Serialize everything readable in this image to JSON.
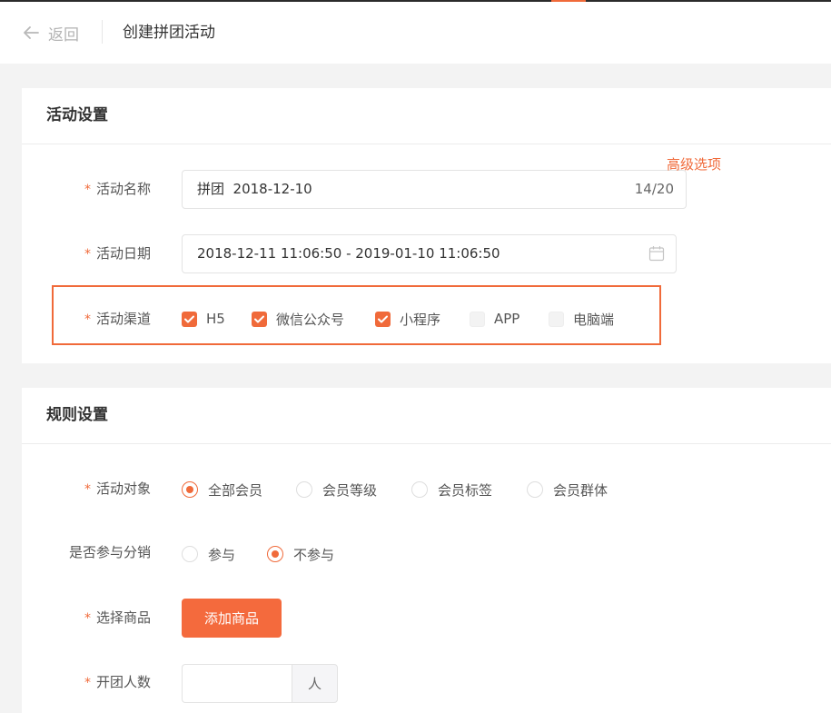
{
  "header": {
    "back_label": "返回",
    "title": "创建拼团活动"
  },
  "activity_settings": {
    "section_title": "活动设置",
    "name": {
      "label": "活动名称",
      "value": "拼团  2018-12-10",
      "counter": "14/20"
    },
    "date": {
      "label": "活动日期",
      "value": "2018-12-11 11:06:50 - 2019-01-10 11:06:50",
      "advanced_link": "高级选项"
    },
    "channels": {
      "label": "活动渠道",
      "options": [
        {
          "label": "H5",
          "checked": true
        },
        {
          "label": "微信公众号",
          "checked": true
        },
        {
          "label": "小程序",
          "checked": true
        },
        {
          "label": "APP",
          "checked": false
        },
        {
          "label": "电脑端",
          "checked": false
        }
      ]
    }
  },
  "rule_settings": {
    "section_title": "规则设置",
    "target": {
      "label": "活动对象",
      "options": [
        {
          "label": "全部会员",
          "selected": true
        },
        {
          "label": "会员等级",
          "selected": false
        },
        {
          "label": "会员标签",
          "selected": false
        },
        {
          "label": "会员群体",
          "selected": false
        }
      ]
    },
    "distribution": {
      "label": "是否参与分销",
      "options": [
        {
          "label": "参与",
          "selected": false
        },
        {
          "label": "不参与",
          "selected": true
        }
      ]
    },
    "product": {
      "label": "选择商品",
      "button_label": "添加商品"
    },
    "group_size": {
      "label": "开团人数",
      "value": "",
      "unit": "人"
    }
  },
  "colors": {
    "accent": "#f06a3a",
    "checkbox_unchecked": "#f3f3f3",
    "page_background": "#f3f3f3"
  }
}
